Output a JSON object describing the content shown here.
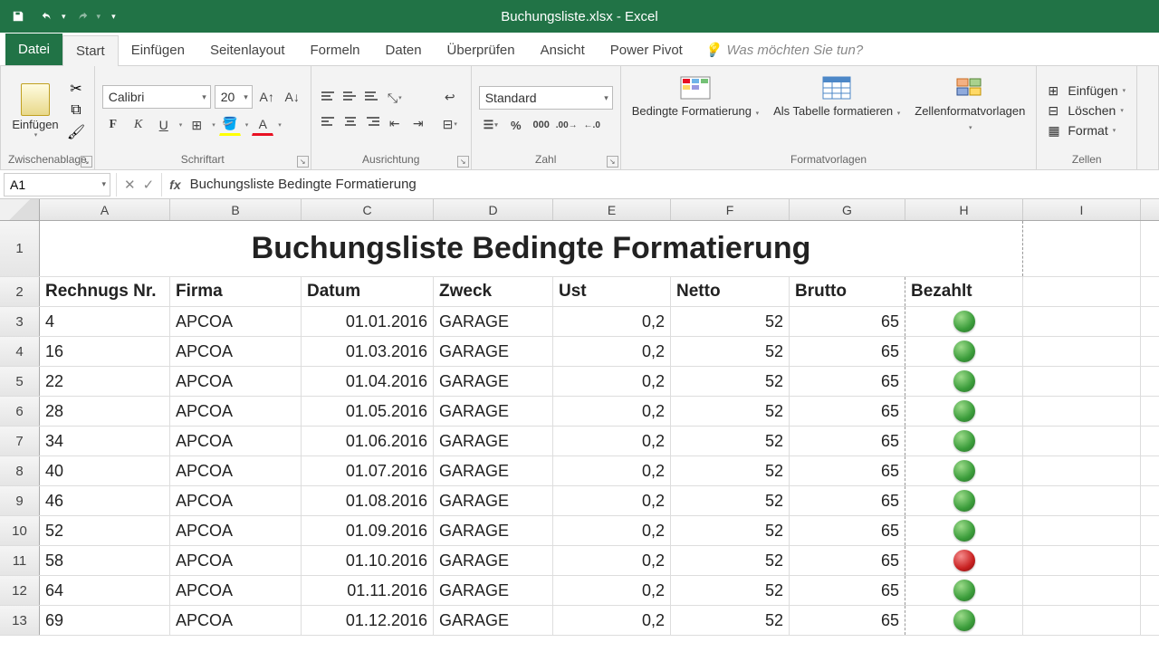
{
  "app": {
    "title": "Buchungsliste.xlsx - Excel"
  },
  "tabs": {
    "file": "Datei",
    "home": "Start",
    "insert": "Einfügen",
    "layout": "Seitenlayout",
    "formulas": "Formeln",
    "data": "Daten",
    "review": "Überprüfen",
    "view": "Ansicht",
    "powerpivot": "Power Pivot",
    "tellme": "Was möchten Sie tun?"
  },
  "ribbon": {
    "clipboard": {
      "paste": "Einfügen",
      "group": "Zwischenablage"
    },
    "font": {
      "name": "Calibri",
      "size": "20",
      "group": "Schriftart"
    },
    "alignment": {
      "group": "Ausrichtung"
    },
    "number": {
      "format": "Standard",
      "group": "Zahl"
    },
    "styles": {
      "cond": "Bedingte Formatierung",
      "table": "Als Tabelle formatieren",
      "cellstyles": "Zellenformatvorlagen",
      "group": "Formatvorlagen"
    },
    "cells": {
      "insert": "Einfügen",
      "delete": "Löschen",
      "format": "Format",
      "group": "Zellen"
    }
  },
  "namebox": "A1",
  "formula": "Buchungsliste Bedingte Formatierung",
  "columns": [
    "A",
    "B",
    "C",
    "D",
    "E",
    "F",
    "G",
    "H",
    "I"
  ],
  "sheet": {
    "title": "Buchungsliste Bedingte Formatierung",
    "headers": {
      "nr": "Rechnugs Nr.",
      "firma": "Firma",
      "datum": "Datum",
      "zweck": "Zweck",
      "ust": "Ust",
      "netto": "Netto",
      "brutto": "Brutto",
      "bezahlt": "Bezahlt"
    },
    "rows": [
      {
        "r": 3,
        "nr": "4",
        "firma": "APCOA",
        "datum": "01.01.2016",
        "zweck": "GARAGE",
        "ust": "0,2",
        "netto": "52",
        "brutto": "65",
        "paid": "green"
      },
      {
        "r": 4,
        "nr": "16",
        "firma": "APCOA",
        "datum": "01.03.2016",
        "zweck": "GARAGE",
        "ust": "0,2",
        "netto": "52",
        "brutto": "65",
        "paid": "green"
      },
      {
        "r": 5,
        "nr": "22",
        "firma": "APCOA",
        "datum": "01.04.2016",
        "zweck": "GARAGE",
        "ust": "0,2",
        "netto": "52",
        "brutto": "65",
        "paid": "green"
      },
      {
        "r": 6,
        "nr": "28",
        "firma": "APCOA",
        "datum": "01.05.2016",
        "zweck": "GARAGE",
        "ust": "0,2",
        "netto": "52",
        "brutto": "65",
        "paid": "green"
      },
      {
        "r": 7,
        "nr": "34",
        "firma": "APCOA",
        "datum": "01.06.2016",
        "zweck": "GARAGE",
        "ust": "0,2",
        "netto": "52",
        "brutto": "65",
        "paid": "green"
      },
      {
        "r": 8,
        "nr": "40",
        "firma": "APCOA",
        "datum": "01.07.2016",
        "zweck": "GARAGE",
        "ust": "0,2",
        "netto": "52",
        "brutto": "65",
        "paid": "green"
      },
      {
        "r": 9,
        "nr": "46",
        "firma": "APCOA",
        "datum": "01.08.2016",
        "zweck": "GARAGE",
        "ust": "0,2",
        "netto": "52",
        "brutto": "65",
        "paid": "green"
      },
      {
        "r": 10,
        "nr": "52",
        "firma": "APCOA",
        "datum": "01.09.2016",
        "zweck": "GARAGE",
        "ust": "0,2",
        "netto": "52",
        "brutto": "65",
        "paid": "green"
      },
      {
        "r": 11,
        "nr": "58",
        "firma": "APCOA",
        "datum": "01.10.2016",
        "zweck": "GARAGE",
        "ust": "0,2",
        "netto": "52",
        "brutto": "65",
        "paid": "red"
      },
      {
        "r": 12,
        "nr": "64",
        "firma": "APCOA",
        "datum": "01.11.2016",
        "zweck": "GARAGE",
        "ust": "0,2",
        "netto": "52",
        "brutto": "65",
        "paid": "green"
      },
      {
        "r": 13,
        "nr": "69",
        "firma": "APCOA",
        "datum": "01.12.2016",
        "zweck": "GARAGE",
        "ust": "0,2",
        "netto": "52",
        "brutto": "65",
        "paid": "green"
      }
    ]
  }
}
